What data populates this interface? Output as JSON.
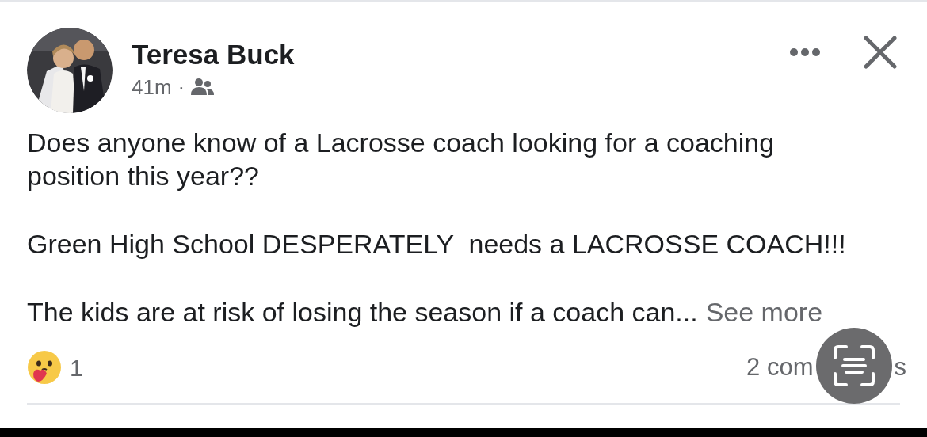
{
  "post": {
    "author": "Teresa Buck",
    "time": "41m",
    "separator": "·",
    "paragraphs": [
      "Does anyone know of a Lacrosse coach looking for a coaching position this year??",
      "Green High School DESPERATELY  needs a LACROSSE COACH!!!",
      "The kids are at risk of losing the season if a coach can..."
    ],
    "see_more": "See more",
    "reaction_count": "1",
    "comments_start": "2 com",
    "comments_end": "s"
  },
  "overlay": {
    "kind": "text-scan"
  }
}
